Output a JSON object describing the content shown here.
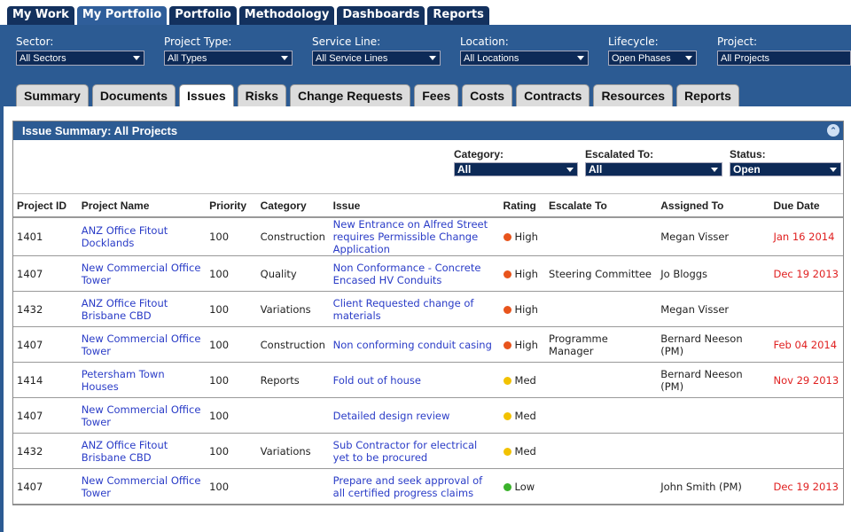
{
  "topnav": {
    "tabs": [
      {
        "label": "My Work",
        "active": false
      },
      {
        "label": "My Portfolio",
        "active": true
      },
      {
        "label": "Portfolio",
        "active": false
      },
      {
        "label": "Methodology",
        "active": false
      },
      {
        "label": "Dashboards",
        "active": false
      },
      {
        "label": "Reports",
        "active": false
      }
    ]
  },
  "filters": {
    "sector": {
      "label": "Sector:",
      "value": "All Sectors"
    },
    "project_type": {
      "label": "Project Type:",
      "value": "All Types"
    },
    "service_line": {
      "label": "Service Line:",
      "value": "All Service Lines"
    },
    "location": {
      "label": "Location:",
      "value": "All Locations"
    },
    "lifecycle": {
      "label": "Lifecycle:",
      "value": "Open Phases"
    },
    "project": {
      "label": "Project:",
      "value": "All Projects"
    }
  },
  "subtabs": [
    {
      "label": "Summary",
      "active": false
    },
    {
      "label": "Documents",
      "active": false
    },
    {
      "label": "Issues",
      "active": true
    },
    {
      "label": "Risks",
      "active": false
    },
    {
      "label": "Change Requests",
      "active": false
    },
    {
      "label": "Fees",
      "active": false
    },
    {
      "label": "Costs",
      "active": false
    },
    {
      "label": "Contracts",
      "active": false
    },
    {
      "label": "Resources",
      "active": false
    },
    {
      "label": "Reports",
      "active": false
    }
  ],
  "panel": {
    "title": "Issue Summary: All Projects",
    "category": {
      "label": "Category:",
      "value": "All"
    },
    "escalated": {
      "label": "Escalated To:",
      "value": "All"
    },
    "status": {
      "label": "Status:",
      "value": "Open"
    }
  },
  "rating_colors": {
    "High": "#e8541c",
    "Med": "#f2c200",
    "Low": "#3bb22b"
  },
  "table": {
    "headers": [
      "Project ID",
      "Project Name",
      "Priority",
      "Category",
      "Issue",
      "Rating",
      "Escalate To",
      "Assigned To",
      "Due Date"
    ],
    "rows": [
      {
        "id": "1401",
        "name": "ANZ Office Fitout Docklands",
        "priority": "100",
        "category": "Construction",
        "issue": "New Entrance on Alfred Street requires Permissible Change Application",
        "rating": "High",
        "escalate": "",
        "assigned": "Megan Visser",
        "due": "Jan 16 2014"
      },
      {
        "id": "1407",
        "name": "New Commercial Office Tower",
        "priority": "100",
        "category": "Quality",
        "issue": "Non Conformance - Concrete Encased HV Conduits",
        "rating": "High",
        "escalate": "Steering Committee",
        "assigned": "Jo Bloggs",
        "due": "Dec 19 2013"
      },
      {
        "id": "1432",
        "name": "ANZ Office Fitout Brisbane CBD",
        "priority": "100",
        "category": "Variations",
        "issue": "Client Requested change of materials",
        "rating": "High",
        "escalate": "",
        "assigned": "Megan Visser",
        "due": ""
      },
      {
        "id": "1407",
        "name": "New Commercial Office Tower",
        "priority": "100",
        "category": "Construction",
        "issue": "Non conforming conduit casing",
        "rating": "High",
        "escalate": "Programme Manager",
        "assigned": "Bernard Neeson (PM)",
        "due": "Feb 04 2014"
      },
      {
        "id": "1414",
        "name": "Petersham Town Houses",
        "priority": "100",
        "category": "Reports",
        "issue": "Fold out of house",
        "rating": "Med",
        "escalate": "",
        "assigned": "Bernard Neeson (PM)",
        "due": "Nov 29 2013"
      },
      {
        "id": "1407",
        "name": "New Commercial Office Tower",
        "priority": "100",
        "category": "",
        "issue": "Detailed design review",
        "rating": "Med",
        "escalate": "",
        "assigned": "",
        "due": ""
      },
      {
        "id": "1432",
        "name": "ANZ Office Fitout Brisbane CBD",
        "priority": "100",
        "category": "Variations",
        "issue": "Sub Contractor for electrical yet to be procured",
        "rating": "Med",
        "escalate": "",
        "assigned": "",
        "due": ""
      },
      {
        "id": "1407",
        "name": "New Commercial Office Tower",
        "priority": "100",
        "category": "",
        "issue": "Prepare and seek approval of all certified progress claims",
        "rating": "Low",
        "escalate": "",
        "assigned": "John Smith (PM)",
        "due": "Dec 19 2013"
      }
    ]
  }
}
